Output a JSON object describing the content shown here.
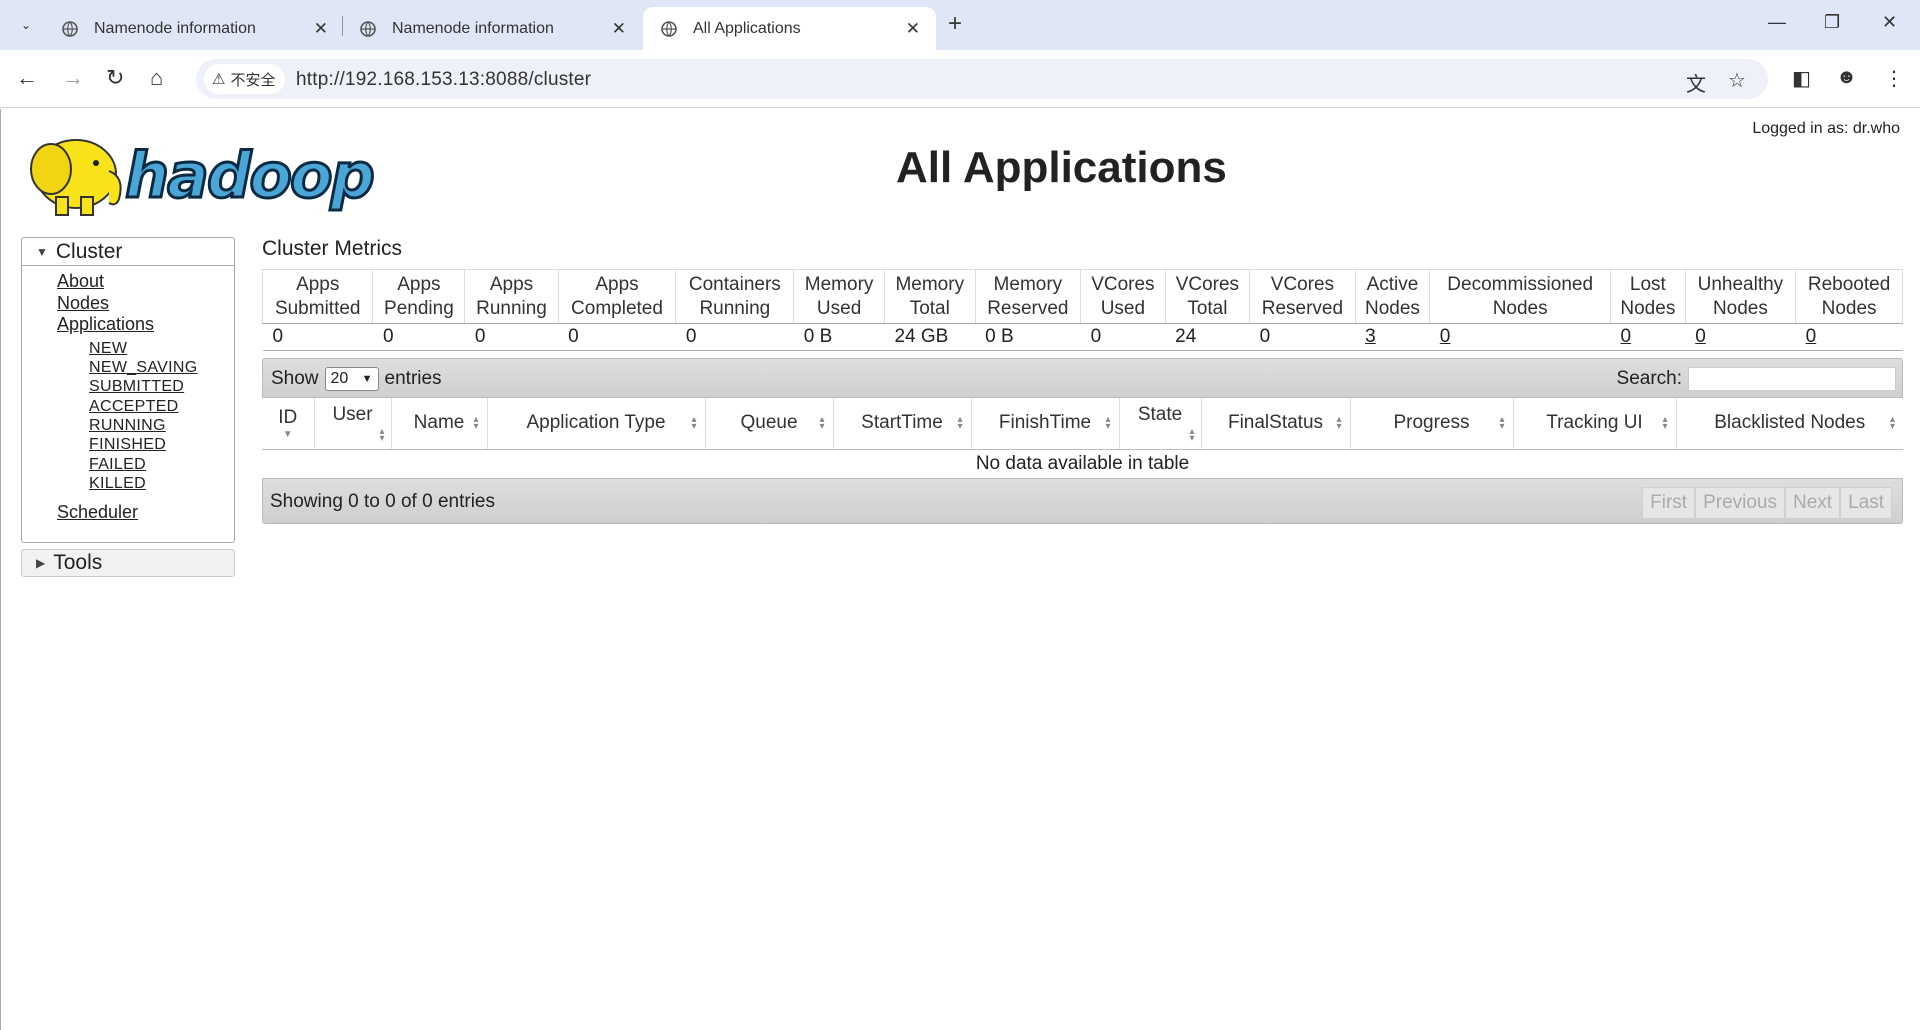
{
  "browser": {
    "tabs": [
      {
        "title": "Namenode information"
      },
      {
        "title": "Namenode information"
      },
      {
        "title": "All Applications"
      }
    ],
    "security_label": "不安全",
    "url": "http://192.168.153.13:8088/cluster"
  },
  "header": {
    "logged_in": "Logged in as: dr.who",
    "title": "All Applications",
    "logo_text": "hadoop"
  },
  "sidebar": {
    "cluster_label": "Cluster",
    "links": [
      "About",
      "Nodes",
      "Applications"
    ],
    "app_states": [
      "NEW",
      "NEW_SAVING",
      "SUBMITTED",
      "ACCEPTED",
      "RUNNING",
      "FINISHED",
      "FAILED",
      "KILLED"
    ],
    "scheduler": "Scheduler",
    "tools_label": "Tools"
  },
  "metrics": {
    "title": "Cluster Metrics",
    "headers": [
      [
        "Apps",
        "Submitted"
      ],
      [
        "Apps",
        "Pending"
      ],
      [
        "Apps",
        "Running"
      ],
      [
        "Apps",
        "Completed"
      ],
      [
        "Containers",
        "Running"
      ],
      [
        "Memory",
        "Used"
      ],
      [
        "Memory",
        "Total"
      ],
      [
        "Memory",
        "Reserved"
      ],
      [
        "VCores",
        "Used"
      ],
      [
        "VCores",
        "Total"
      ],
      [
        "VCores",
        "Reserved"
      ],
      [
        "Active",
        "Nodes"
      ],
      [
        "Decommissioned",
        "Nodes"
      ],
      [
        "Lost",
        "Nodes"
      ],
      [
        "Unhealthy",
        "Nodes"
      ],
      [
        "Rebooted",
        "Nodes"
      ]
    ],
    "values": [
      "0",
      "0",
      "0",
      "0",
      "0",
      "0 B",
      "24 GB",
      "0 B",
      "0",
      "24",
      "0",
      "3",
      "0",
      "0",
      "0",
      "0"
    ]
  },
  "apps_table": {
    "show_label": "Show",
    "entries_value": "20",
    "entries_label": "entries",
    "search_label": "Search:",
    "columns": [
      "ID",
      "User",
      "Name",
      "Application Type",
      "Queue",
      "StartTime",
      "FinishTime",
      "State",
      "FinalStatus",
      "Progress",
      "Tracking UI",
      "Blacklisted Nodes"
    ],
    "empty_message": "No data available in table",
    "info": "Showing 0 to 0 of 0 entries",
    "pager": [
      "First",
      "Previous",
      "Next",
      "Last"
    ]
  }
}
